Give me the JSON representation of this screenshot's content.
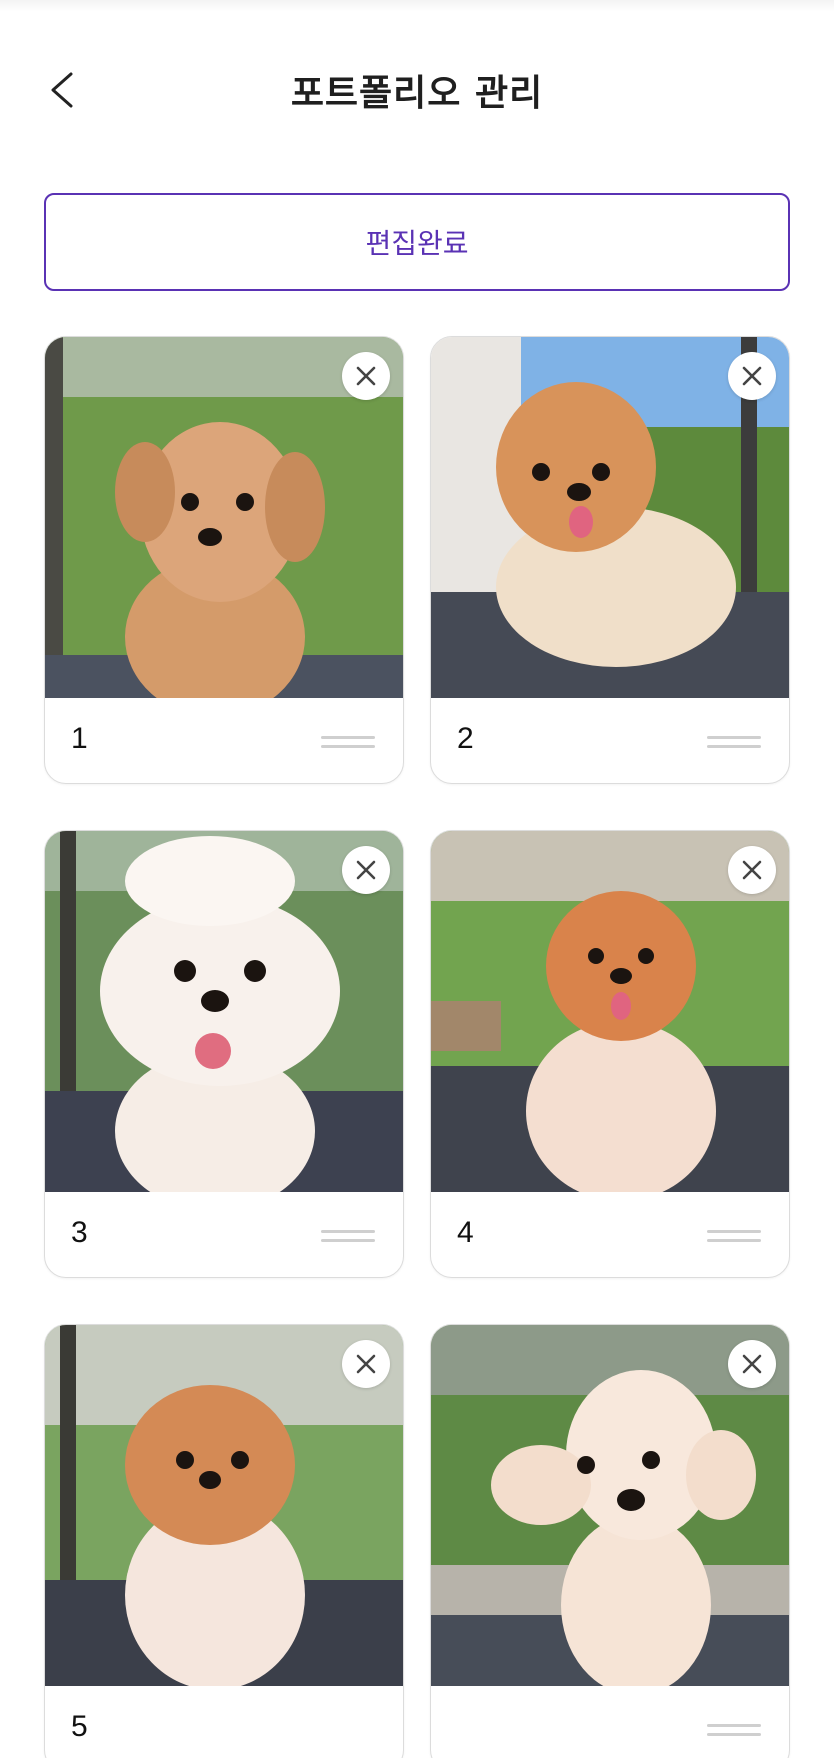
{
  "header": {
    "title": "포트폴리오 관리",
    "back_icon": "chevron-left-icon"
  },
  "actions": {
    "done_label": "편집완료"
  },
  "colors": {
    "accent": "#5a32b4",
    "card_border": "#dcdcdc",
    "handle": "#cfcfcf"
  },
  "portfolio": {
    "items": [
      {
        "number": "1",
        "photo": "apricot poodle dog photo"
      },
      {
        "number": "2",
        "photo": "pomeranian dog photo"
      },
      {
        "number": "3",
        "photo": "white bichon dog photo"
      },
      {
        "number": "4",
        "photo": "orange pomeranian dog photo"
      },
      {
        "number": "5",
        "photo": "pomeranian dog photo"
      },
      {
        "number": "",
        "photo": "cream poodle dog photo"
      }
    ]
  }
}
